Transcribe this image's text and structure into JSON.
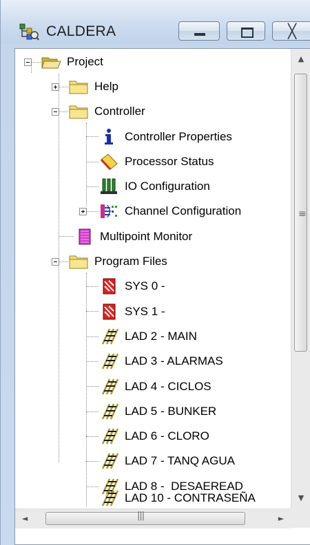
{
  "window": {
    "title": "CALDERA",
    "icon": "project-tree-icon",
    "controls": {
      "minimize": "minimize-icon",
      "maximize": "maximize-icon",
      "close": "╳"
    }
  },
  "tree": {
    "items": [
      {
        "label": "Project",
        "icon": "open-folder-icon"
      },
      {
        "label": "Help",
        "icon": "folder-icon"
      },
      {
        "label": "Controller",
        "icon": "folder-icon"
      },
      {
        "label": "Controller Properties",
        "icon": "info-icon"
      },
      {
        "label": "Processor Status",
        "icon": "processor-status-icon"
      },
      {
        "label": "IO Configuration",
        "icon": "io-configuration-icon"
      },
      {
        "label": "Channel Configuration",
        "icon": "channel-configuration-icon"
      },
      {
        "label": "Multipoint Monitor",
        "icon": "monitor-icon"
      },
      {
        "label": "Program Files",
        "icon": "folder-icon"
      },
      {
        "label": "SYS 0 -",
        "icon": "sys-file-icon"
      },
      {
        "label": "SYS 1 -",
        "icon": "sys-file-icon"
      },
      {
        "label": "LAD 2 - MAIN",
        "icon": "ladder-file-icon"
      },
      {
        "label": "LAD 3 - ALARMAS",
        "icon": "ladder-file-icon"
      },
      {
        "label": "LAD 4 - CICLOS",
        "icon": "ladder-file-icon"
      },
      {
        "label": "LAD 5 - BUNKER",
        "icon": "ladder-file-icon"
      },
      {
        "label": "LAD 6 - CLORO",
        "icon": "ladder-file-icon"
      },
      {
        "label": "LAD 7 - TANQ AGUA",
        "icon": "ladder-file-icon"
      },
      {
        "label": "LAD 8 -  DESAEREAD",
        "icon": "ladder-file-icon"
      },
      {
        "label": "LAD 10 - CONTRASEÑA",
        "icon": "ladder-file-icon"
      }
    ]
  },
  "scrollbars": {
    "vertical": {
      "up": "▲",
      "down": "▼",
      "grip": "≡"
    },
    "horizontal": {
      "left": "◄",
      "right": "►",
      "grip": "|||"
    }
  }
}
